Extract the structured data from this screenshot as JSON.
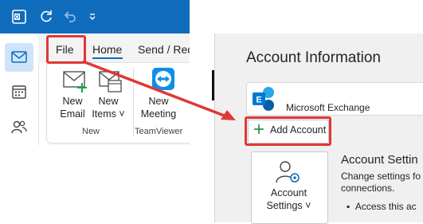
{
  "titlebar": {
    "color": "#0f6cbd",
    "icons": [
      "outlook-icon",
      "sync-icon",
      "undo-icon",
      "customize-dropdown-icon"
    ]
  },
  "rail": {
    "icons": [
      "mail-icon",
      "calendar-icon",
      "people-icon"
    ],
    "selected": "mail-icon"
  },
  "tabs": [
    {
      "label": "File",
      "highlighted": true
    },
    {
      "label": "Home",
      "selected": true
    },
    {
      "label": "Send / Rece"
    }
  ],
  "ribbon": {
    "buttons": [
      {
        "line1": "New",
        "line2": "Email"
      },
      {
        "line1": "New",
        "line2": "Items ˅"
      },
      {
        "line1": "New",
        "line2": "Meeting"
      }
    ],
    "groups": [
      "New",
      "TeamViewer"
    ]
  },
  "account": {
    "title": "Account Information",
    "exchange_label": "Microsoft Exchange",
    "add_account": "Add Account",
    "settings_button": {
      "line1": "Account",
      "line2": "Settings ˅"
    },
    "settings_heading": "Account Settin",
    "settings_desc_1": "Change settings fo",
    "settings_desc_2": "connections.",
    "bullet": "Access this ac"
  },
  "colors": {
    "accent": "#0f6cbd",
    "highlight": "#e03838",
    "panel": "#f0f0f0"
  }
}
